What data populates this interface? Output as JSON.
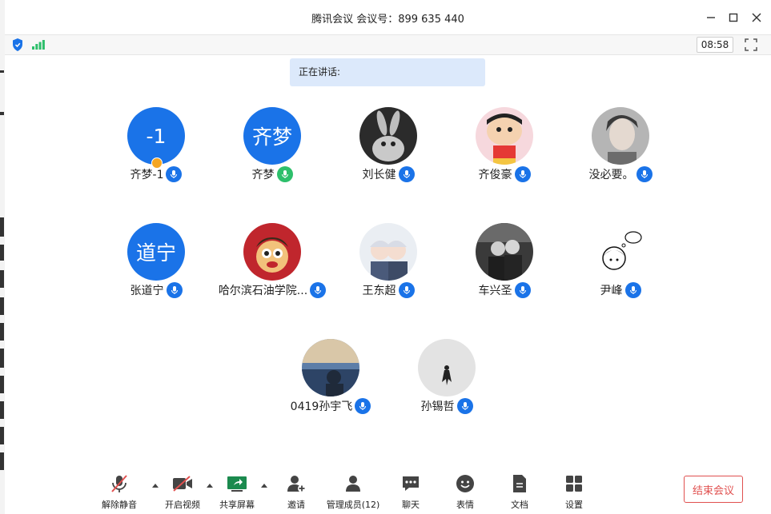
{
  "window": {
    "title": "腾讯会议 会议号：899 635 440"
  },
  "statusbar": {
    "timer": "08:58"
  },
  "speaking": {
    "label": "正在讲话:"
  },
  "participants": [
    {
      "name": "齐梦-1",
      "avatar_text": "-1",
      "mic": "active"
    },
    {
      "name": "齐梦",
      "avatar_text": "齐梦",
      "mic": "speaking"
    },
    {
      "name": "刘长健",
      "avatar_text": "",
      "mic": "active"
    },
    {
      "name": "齐俊豪",
      "avatar_text": "",
      "mic": "active"
    },
    {
      "name": "没必要。",
      "avatar_text": "",
      "mic": "active"
    },
    {
      "name": "张道宁",
      "avatar_text": "道宁",
      "mic": "active"
    },
    {
      "name": "哈尔滨石油学院...",
      "avatar_text": "",
      "mic": "active"
    },
    {
      "name": "王东超",
      "avatar_text": "",
      "mic": "active"
    },
    {
      "name": "车兴圣",
      "avatar_text": "",
      "mic": "active"
    },
    {
      "name": "尹峰",
      "avatar_text": "",
      "mic": "active"
    },
    {
      "name": "0419孙宇飞",
      "avatar_text": "",
      "mic": "active"
    },
    {
      "name": "孙锡哲",
      "avatar_text": "",
      "mic": "active"
    }
  ],
  "toolbar": {
    "unmute": "解除静音",
    "start_video": "开启视频",
    "share_screen": "共享屏幕",
    "invite": "邀请",
    "manage_members": "管理成员(12)",
    "chat": "聊天",
    "reactions": "表情",
    "documents": "文档",
    "settings": "设置",
    "end_meeting": "结束会议"
  },
  "colors": {
    "accent": "#1a73e8",
    "speaking_mic": "#2dbf6b",
    "end": "#e0504f",
    "speaking_bg": "#dce9fb"
  }
}
